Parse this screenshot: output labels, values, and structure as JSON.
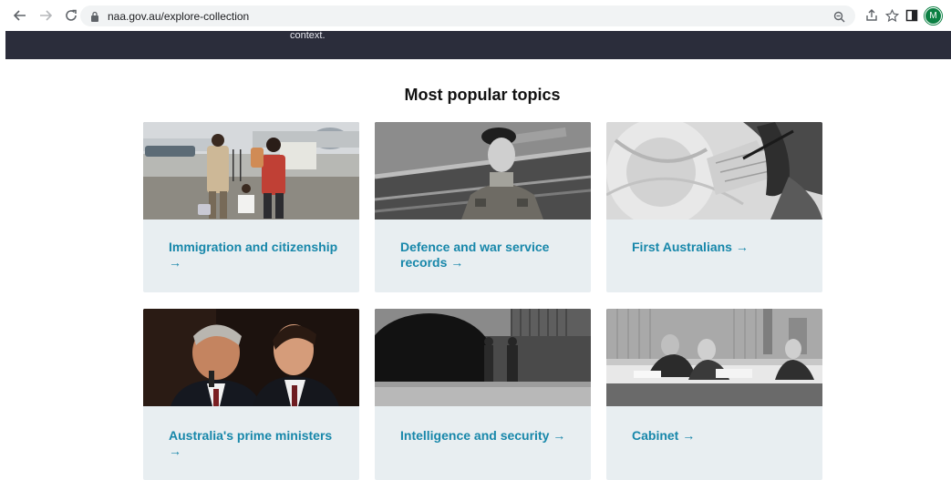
{
  "browser": {
    "url": "naa.gov.au/explore-collection",
    "avatar_initial": "M"
  },
  "banner": {
    "text": "context."
  },
  "topics": {
    "heading": "Most popular topics",
    "cards": [
      {
        "title": "Immigration and citizenship",
        "arrow": "→"
      },
      {
        "title": "Defence and war service records",
        "arrow": "→"
      },
      {
        "title": "First Australians",
        "arrow": "→"
      },
      {
        "title": "Australia's prime ministers",
        "arrow": "→"
      },
      {
        "title": "Intelligence and security",
        "arrow": "→"
      },
      {
        "title": "Cabinet",
        "arrow": "→"
      }
    ]
  },
  "colors": {
    "accent": "#1787aa",
    "card_bg": "#e8eef1",
    "banner_bg": "#2b2d3b",
    "avatar": "#0b8043"
  }
}
